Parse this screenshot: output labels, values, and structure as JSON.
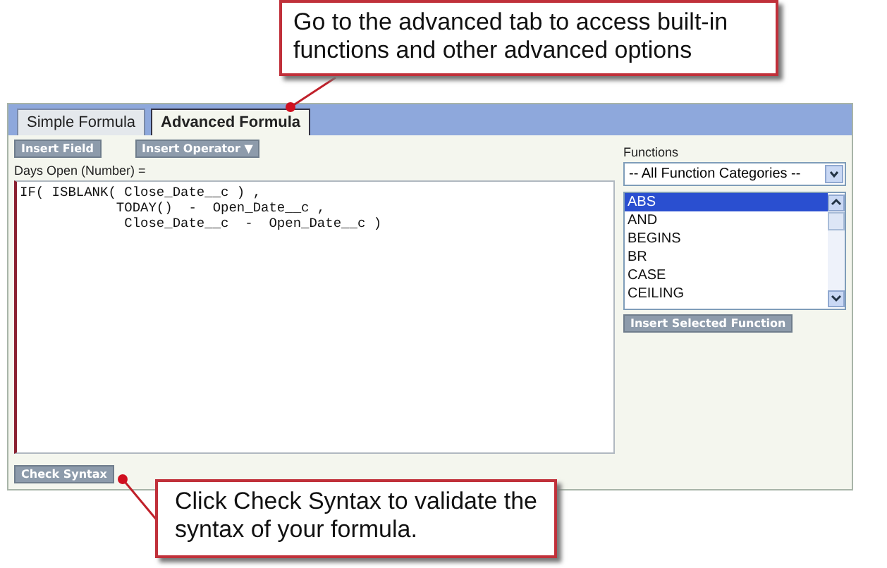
{
  "tabs": [
    {
      "label": "Simple Formula",
      "selected": false
    },
    {
      "label": "Advanced Formula",
      "selected": true
    }
  ],
  "toolbar": {
    "insert_field": "Insert Field",
    "insert_operator": "Insert Operator",
    "operator_caret": "▼"
  },
  "formula_label": "Days Open (Number) =",
  "formula": "IF( ISBLANK( Close_Date__c ) ,\n            TODAY()  -  Open_Date__c ,\n             Close_Date__c  -  Open_Date__c )",
  "functions": {
    "label": "Functions",
    "category": "-- All Function Categories --",
    "items": [
      {
        "name": "ABS",
        "selected": true
      },
      {
        "name": "AND",
        "selected": false
      },
      {
        "name": "BEGINS",
        "selected": false
      },
      {
        "name": "BR",
        "selected": false
      },
      {
        "name": "CASE",
        "selected": false
      },
      {
        "name": "CEILING",
        "selected": false
      }
    ],
    "insert_button": "Insert Selected Function"
  },
  "check_syntax": "Check Syntax",
  "callouts": [
    {
      "text": "Go to the advanced tab to access built-in functions and other advanced options"
    },
    {
      "text": "Click Check Syntax to validate the syntax of your formula."
    }
  ]
}
